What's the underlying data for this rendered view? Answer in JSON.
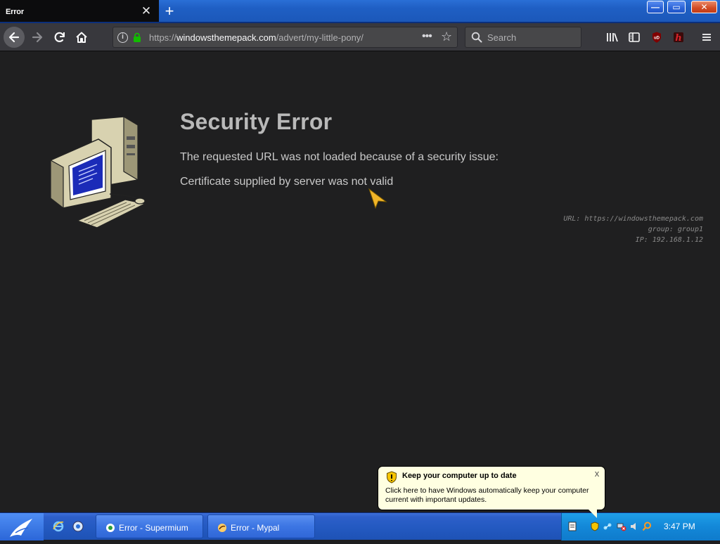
{
  "browser": {
    "tab_title": "Error",
    "tab_close_glyph": "✕",
    "new_tab_glyph": "+",
    "url_prefix": "https://",
    "url_domain": "windowsthemepack.com",
    "url_path": "/advert/my-little-pony/",
    "search_placeholder": "Search",
    "window_controls": {
      "minimize": "—",
      "maximize": "▭",
      "close": "✕"
    },
    "icons": [
      "back-arrow-icon",
      "forward-arrow-icon",
      "reload-icon",
      "home-icon",
      "info-icon",
      "lock-icon",
      "page-actions-icon",
      "bookmark-star-icon",
      "search-icon",
      "library-icon",
      "sidebar-icon",
      "ublock-icon",
      "extension-h-icon",
      "hamburger-menu-icon"
    ]
  },
  "page": {
    "title": "Security Error",
    "line1": "The requested URL was not loaded because of a security issue:",
    "line2": "Certificate supplied by server was not valid",
    "meta_url": "URL: https://windowsthemepack.com",
    "meta_group": "group: group1",
    "meta_ip": "IP: 192.168.1.12"
  },
  "balloon": {
    "title": "Keep your computer up to date",
    "body": "Click here to have Windows automatically keep your computer current with important updates.",
    "close_glyph": "x"
  },
  "taskbar": {
    "tasks": [
      {
        "label": "Error - Supermium"
      },
      {
        "label": "Error - Mypal"
      }
    ],
    "clock": "3:47 PM"
  },
  "colors": {
    "page_bg": "#1f1f20",
    "toolbar_bg": "#38383d",
    "taskbar_blue": "#245ac2",
    "tray_blue": "#1388d8",
    "balloon_bg": "#ffffe1"
  }
}
